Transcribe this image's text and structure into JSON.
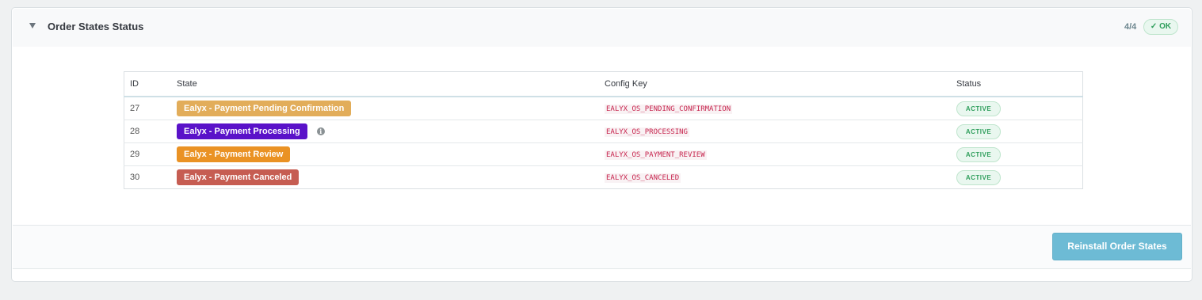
{
  "panel": {
    "title": "Order States Status",
    "count": "4/4",
    "ok_label": "✓ OK"
  },
  "table": {
    "headers": [
      "ID",
      "State",
      "Config Key",
      "Status"
    ],
    "rows": [
      {
        "id": "27",
        "state": "Ealyx - Payment Pending Confirmation",
        "state_color": "#e2ad5a",
        "config_key": "EALYX_OS_PENDING_CONFIRMATION",
        "status": "ACTIVE",
        "info_icon": false
      },
      {
        "id": "28",
        "state": "Ealyx - Payment Processing",
        "state_color": "#5a12c9",
        "config_key": "EALYX_OS_PROCESSING",
        "status": "ACTIVE",
        "info_icon": true
      },
      {
        "id": "29",
        "state": "Ealyx - Payment Review",
        "state_color": "#ea9224",
        "config_key": "EALYX_OS_PAYMENT_REVIEW",
        "status": "ACTIVE",
        "info_icon": false
      },
      {
        "id": "30",
        "state": "Ealyx - Payment Canceled",
        "state_color": "#c65d52",
        "config_key": "EALYX_OS_CANCELED",
        "status": "ACTIVE",
        "info_icon": false
      }
    ]
  },
  "footer": {
    "reinstall_label": "Reinstall Order States"
  },
  "icons": {
    "toggle": "caret-down-icon",
    "info": "info-circle-icon"
  }
}
